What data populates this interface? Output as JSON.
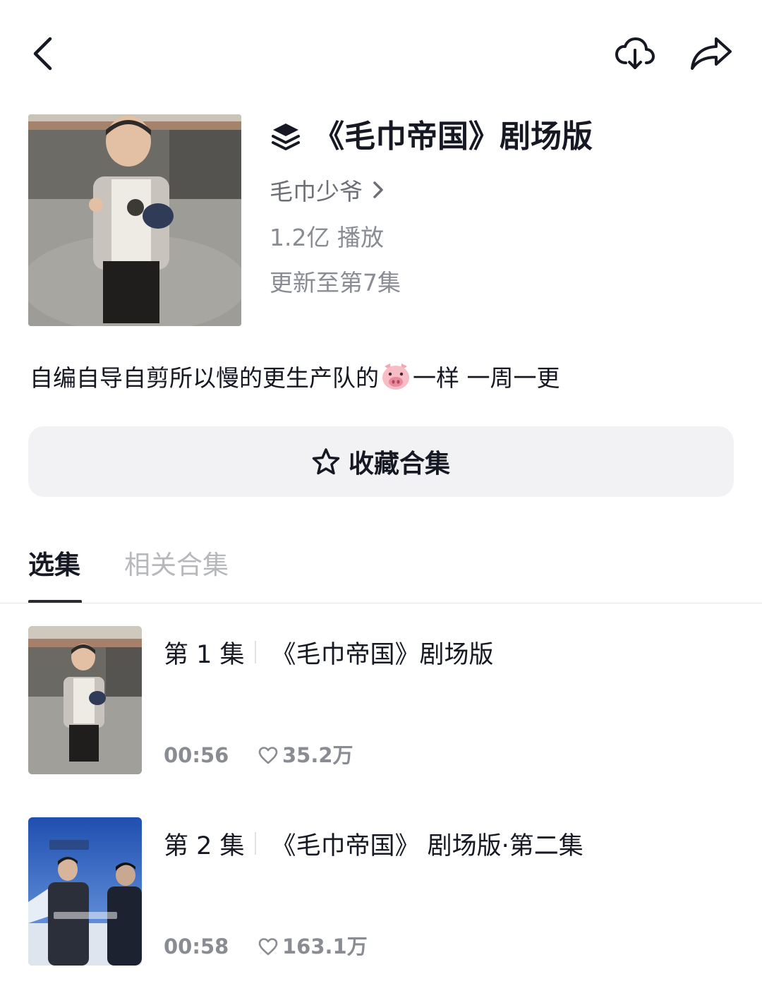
{
  "header": {
    "icons": [
      "back-icon",
      "download-icon",
      "share-icon"
    ]
  },
  "series": {
    "title": "《毛巾帝国》剧场版",
    "author": "毛巾少爷",
    "play_count": "1.2亿 播放",
    "update_status": "更新至第7集",
    "description_before": "自编自导自剪所以慢的更生产队的",
    "description_emoji": "pig-face-emoji",
    "description_after": "一样 一周一更",
    "collect_label": "收藏合集"
  },
  "tabs": {
    "items": [
      {
        "label": "选集",
        "active": true
      },
      {
        "label": "相关合集",
        "active": false
      }
    ]
  },
  "episodes": [
    {
      "number": "第 1 集",
      "title": "《毛巾帝国》剧场版",
      "duration": "00:56",
      "likes": "35.2万"
    },
    {
      "number": "第 2 集",
      "title": "《毛巾帝国》 剧场版·第二集",
      "duration": "00:58",
      "likes": "163.1万"
    }
  ],
  "colors": {
    "text_primary": "#161823",
    "text_secondary": "#8a8c93",
    "button_bg": "#f2f2f4",
    "tab_inactive": "#b7b8bc"
  }
}
